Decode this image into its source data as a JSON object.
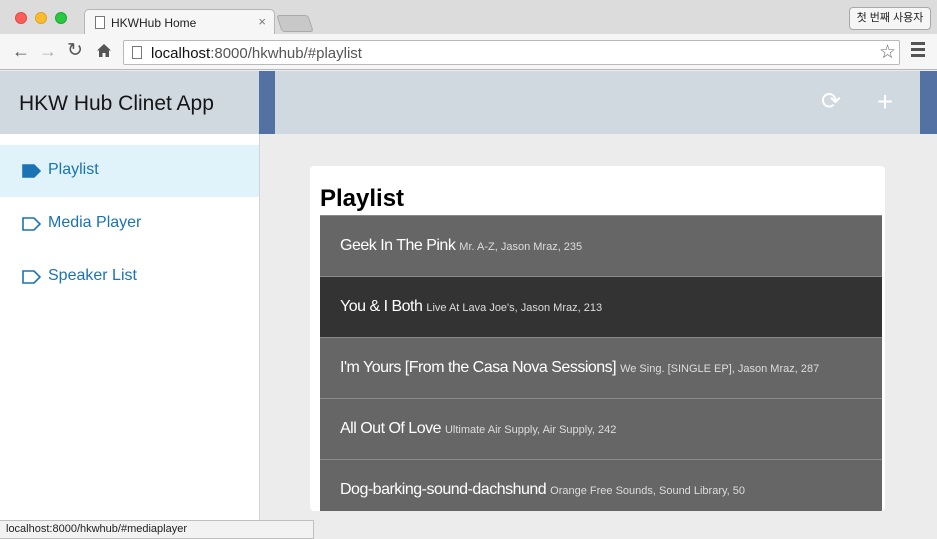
{
  "browser": {
    "tab_title": "HKWHub Home",
    "tab_close": "×",
    "profile_label": "첫 번째 사용자",
    "url_host": "localhost",
    "url_path": ":8000/hkwhub/#playlist",
    "status_url": "localhost:8000/hkwhub/#mediaplayer"
  },
  "app": {
    "title": "HKW Hub Clinet App",
    "refresh_glyph": "⟳",
    "add_glyph": "+"
  },
  "sidebar": {
    "items": [
      {
        "label": "Playlist",
        "active": true
      },
      {
        "label": "Media Player",
        "active": false
      },
      {
        "label": "Speaker List",
        "active": false
      }
    ]
  },
  "playlist": {
    "heading": "Playlist",
    "tracks": [
      {
        "title": "Geek In The Pink",
        "meta": "Mr. A-Z, Jason Mraz, 235",
        "selected": false
      },
      {
        "title": "You & I Both",
        "meta": "Live At Lava Joe's, Jason Mraz, 213",
        "selected": true
      },
      {
        "title": "I'm Yours [From the Casa Nova Sessions]",
        "meta": "We Sing. [SINGLE EP], Jason Mraz, 287",
        "selected": false
      },
      {
        "title": "All Out Of Love",
        "meta": "Ultimate Air Supply, Air Supply, 242",
        "selected": false
      },
      {
        "title": "Dog-barking-sound-dachshund",
        "meta": "Orange Free Sounds, Sound Library, 50",
        "selected": false
      }
    ]
  },
  "colors": {
    "accent_blue": "#5371a2",
    "link_blue": "#1a73b3",
    "active_nav_bg": "#e0f3fa",
    "track_bg": "#666666",
    "track_selected_bg": "#333333"
  },
  "icons": {
    "nav": "tag-icon",
    "header_refresh": "refresh-icon",
    "header_add": "plus-icon"
  }
}
